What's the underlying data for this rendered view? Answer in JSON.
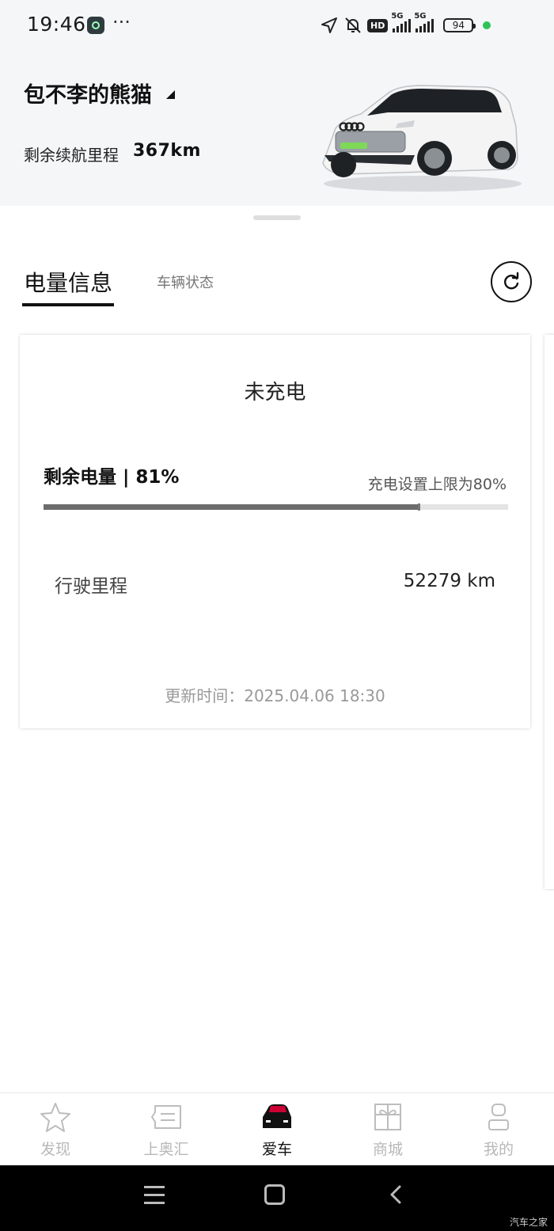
{
  "status_bar": {
    "time": "19:46",
    "overflow": "···",
    "hd_label": "HD",
    "net1": "5G",
    "net2": "5G",
    "battery": "94",
    "icons": [
      "location-arrow-icon",
      "bell-off-icon",
      "hd-icon",
      "signal-5g-icon",
      "signal-5g-icon",
      "battery-icon"
    ]
  },
  "header": {
    "nickname": "包不李的熊猫",
    "range_label": "剩余续航里程",
    "range_value": "367km"
  },
  "tabs": {
    "active": "电量信息",
    "inactive": "车辆状态"
  },
  "card": {
    "charge_status": "未充电",
    "soc_label": "剩余电量 | 81%",
    "soc_percent": 81,
    "charge_limit_text": "充电设置上限为80%",
    "charge_limit_percent": 80,
    "odometer_label": "行驶里程",
    "odometer_value": "52279 km",
    "updated": "更新时间：2025.04.06 18:30"
  },
  "bottom_nav": [
    {
      "label": "发现",
      "icon": "star-icon",
      "active": false
    },
    {
      "label": "上奥汇",
      "icon": "message-icon",
      "active": false
    },
    {
      "label": "爱车",
      "icon": "car-icon",
      "active": true
    },
    {
      "label": "商城",
      "icon": "gift-icon",
      "active": false
    },
    {
      "label": "我的",
      "icon": "user-icon",
      "active": false
    }
  ],
  "watermark": "汽车之家",
  "colors": {
    "header_bg": "#f5f6f8",
    "accent_red": "#cc0033",
    "bar_fill": "#6c6c6c",
    "inactive_nav": "#b8b8b8"
  }
}
